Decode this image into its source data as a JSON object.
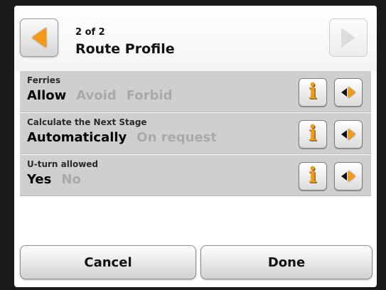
{
  "header": {
    "page_indicator": "2 of 2",
    "title": "Route Profile",
    "back_icon": "chevron-left-icon",
    "forward_icon": "chevron-right-icon"
  },
  "settings": [
    {
      "label": "Ferries",
      "options": [
        "Allow",
        "Avoid",
        "Forbid"
      ],
      "selected": "Allow"
    },
    {
      "label": "Calculate the Next Stage",
      "options": [
        "Automatically",
        "On request"
      ],
      "selected": "Automatically"
    },
    {
      "label": "U-turn allowed",
      "options": [
        "Yes",
        "No"
      ],
      "selected": "Yes"
    }
  ],
  "row_icons": {
    "info_glyph": "i",
    "info_icon": "info-icon",
    "toggle_icon": "cycle-options-icon"
  },
  "footer": {
    "cancel_label": "Cancel",
    "done_label": "Done"
  },
  "colors": {
    "accent": "#f39a16",
    "row_background": "#cfcfcf",
    "selected_text": "#000000",
    "unselected_text": "#a9a9a9"
  }
}
